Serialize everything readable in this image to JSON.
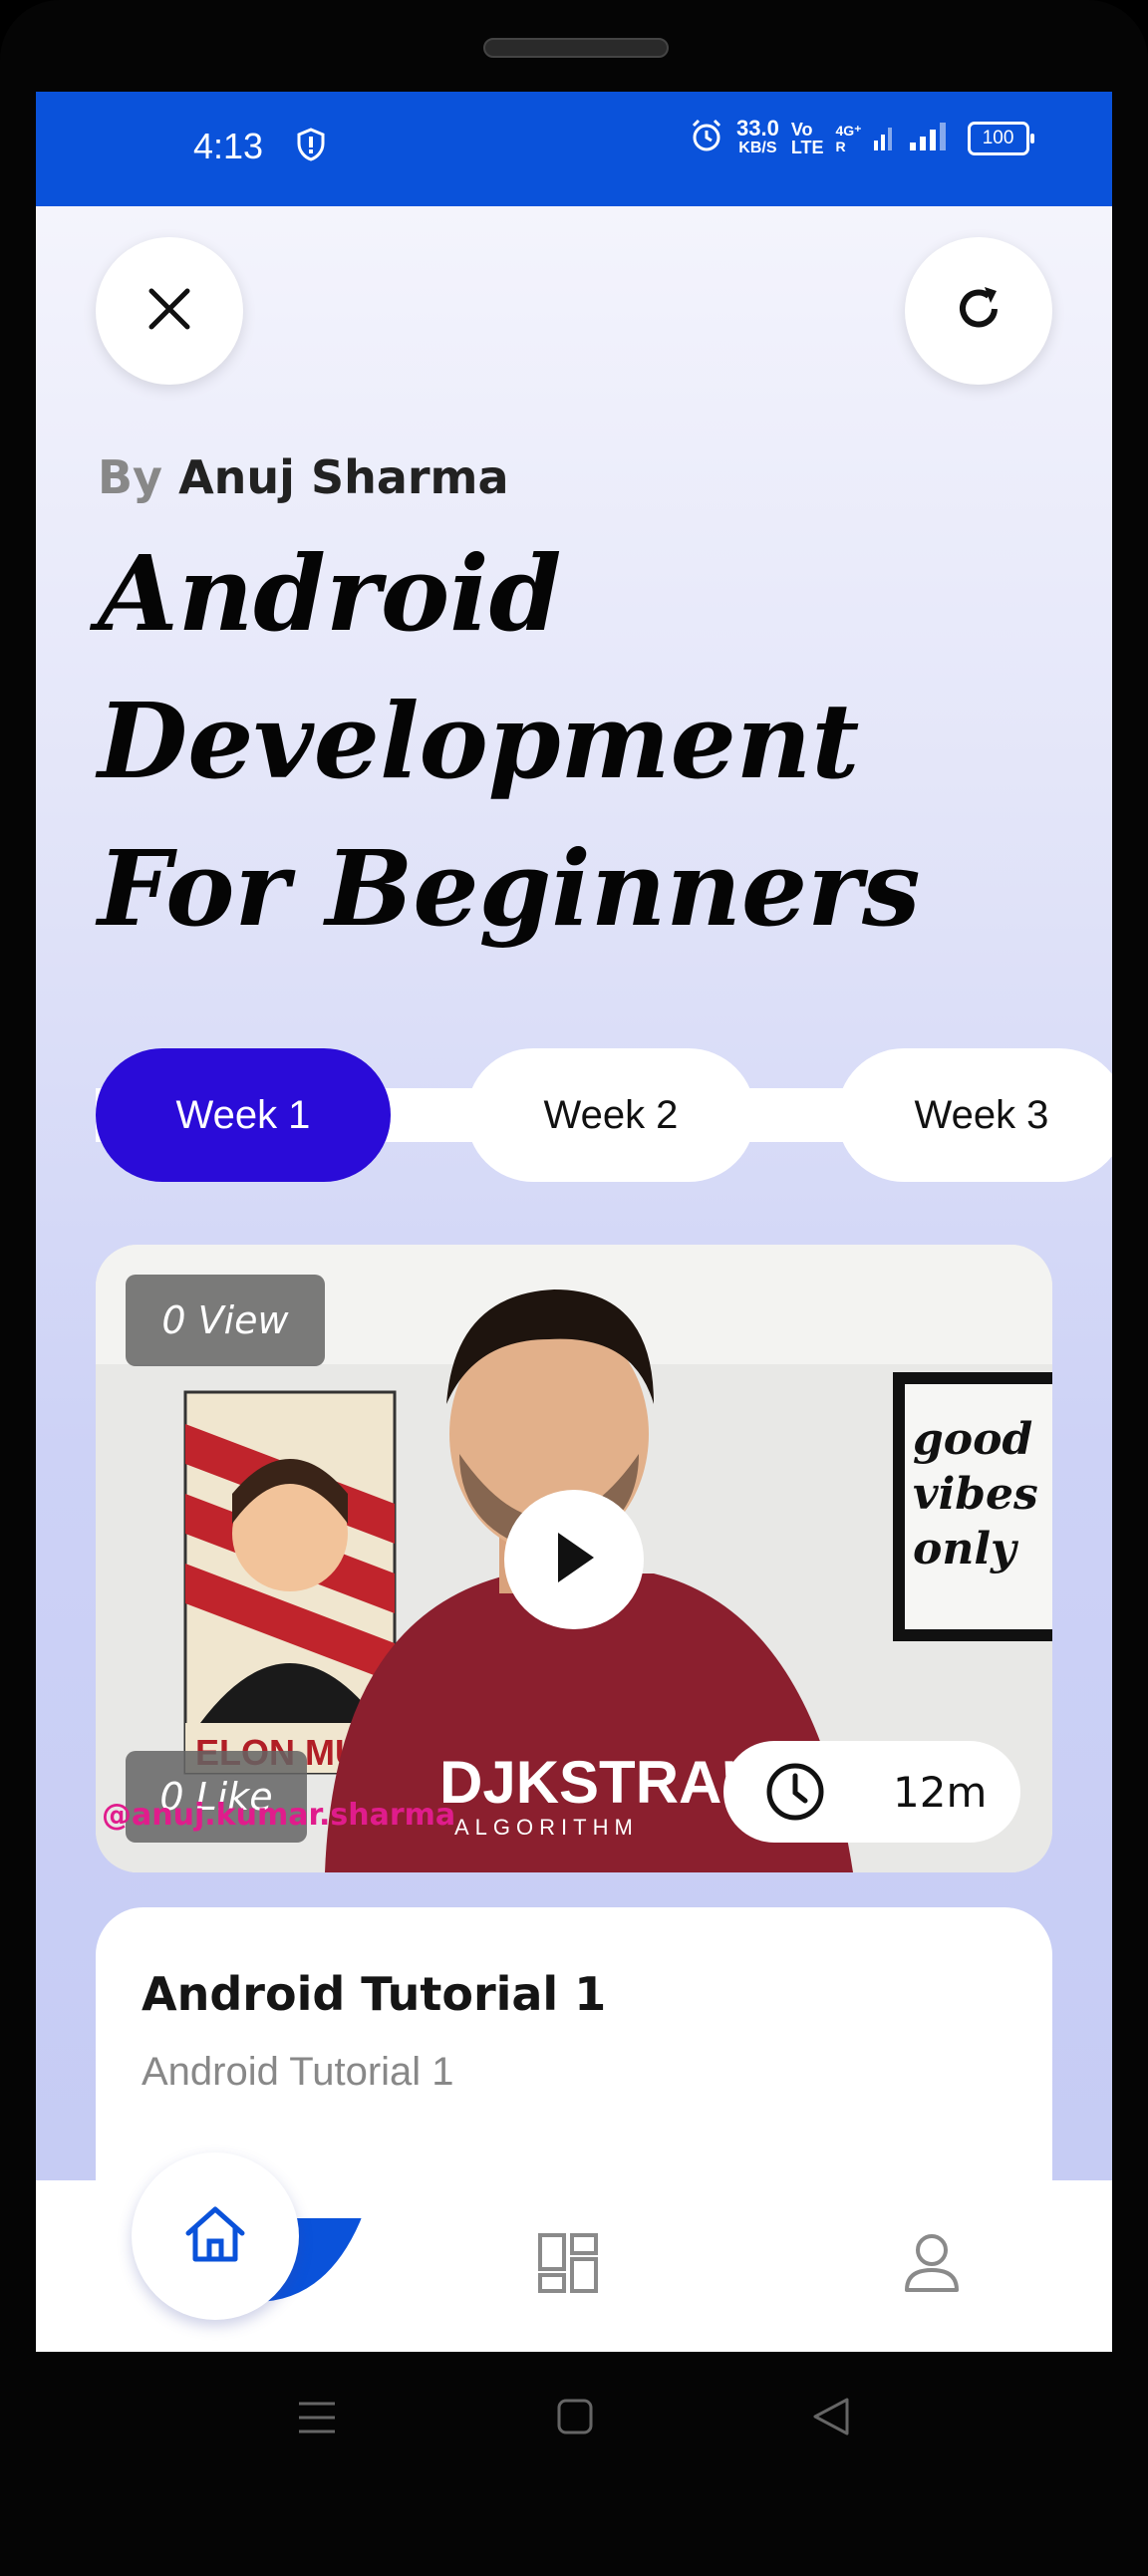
{
  "status_bar": {
    "time": "4:13",
    "net_speed_value": "33.0",
    "net_speed_unit": "KB/S",
    "volte_top": "Vo",
    "volte_bottom": "LTE",
    "network_type_top": "4G⁺",
    "network_type_bottom": "R",
    "battery": "100"
  },
  "header": {
    "author_prefix": "By",
    "author_name": "Anuj Sharma",
    "title": "Android Development For Beginners"
  },
  "tabs": [
    {
      "label": "Week 1",
      "active": true
    },
    {
      "label": "Week 2",
      "active": false
    },
    {
      "label": "Week 3",
      "active": false
    }
  ],
  "video": {
    "views": "0 View",
    "likes": "0 Like",
    "duration": "12m",
    "watermark": "@anuj.kumar.sharma",
    "poster_text": "ELON MUSK",
    "poster_subtext": "ELON MUSK",
    "sign_text": [
      "good",
      "vibes",
      "only"
    ],
    "shirt_text": "DJKSTRA'S",
    "shirt_subtext": "ALGORITHM"
  },
  "lesson_card": {
    "title": "Android Tutorial 1",
    "subtitle": "Android Tutorial 1"
  },
  "icons": {
    "close": "close-icon",
    "refresh": "refresh-icon",
    "home": "home-icon",
    "dashboard": "dashboard-icon",
    "profile": "profile-icon",
    "play": "play-icon",
    "clock": "clock-icon"
  },
  "colors": {
    "status_bar": "#0a52da",
    "active_tab": "#2a0bd8",
    "primary_button": "#0a52da",
    "home_icon": "#0a52da"
  }
}
